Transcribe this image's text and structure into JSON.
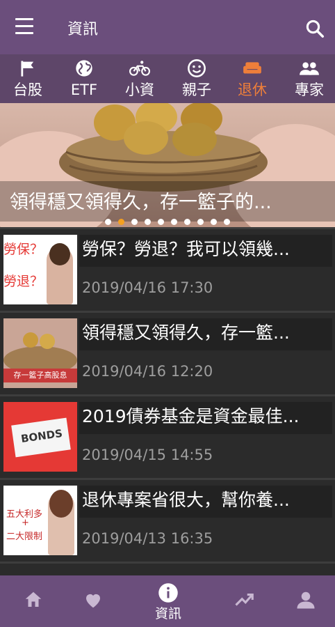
{
  "appbar": {
    "title": "資訊"
  },
  "tabs": [
    {
      "label": "台股",
      "icon": "flag-icon"
    },
    {
      "label": "ETF",
      "icon": "globe-icon"
    },
    {
      "label": "小資",
      "icon": "bicycle-icon"
    },
    {
      "label": "親子",
      "icon": "smile-icon"
    },
    {
      "label": "退休",
      "icon": "sofa-icon",
      "active": true
    },
    {
      "label": "專家",
      "icon": "people-icon"
    }
  ],
  "banner": {
    "caption": "領得穩又領得久，存一籃子的...",
    "slide_index": 1,
    "slide_count": 10
  },
  "articles": [
    {
      "title": "勞保？勞退？我可以領幾...",
      "time": "2019/04/16 17:30",
      "thumb_text_1": "勞保？",
      "thumb_text_2": "勞退？"
    },
    {
      "title": "領得穩又領得久，存一籃...",
      "time": "2019/04/16 12:20",
      "thumb_text_1": "存一籃子高股息"
    },
    {
      "title": "2019債券基金是資金最佳...",
      "time": "2019/04/15 14:55",
      "thumb_text_1": "BONDS"
    },
    {
      "title": "退休專案省很大，幫你養...",
      "time": "2019/04/13 16:35",
      "thumb_text_1": "五大利多",
      "thumb_text_2": "+",
      "thumb_text_3": "二大限制"
    }
  ],
  "bottom_nav": [
    {
      "name": "home-icon"
    },
    {
      "name": "heart-icon"
    },
    {
      "name": "info-icon",
      "label": "資訊",
      "active": true
    },
    {
      "name": "trending-icon"
    },
    {
      "name": "person-icon"
    }
  ],
  "colors": {
    "primary": "#6b4e7c",
    "tab_bar": "#5e4669",
    "accent": "#ee7f3a",
    "dot_active": "#f4a020"
  }
}
